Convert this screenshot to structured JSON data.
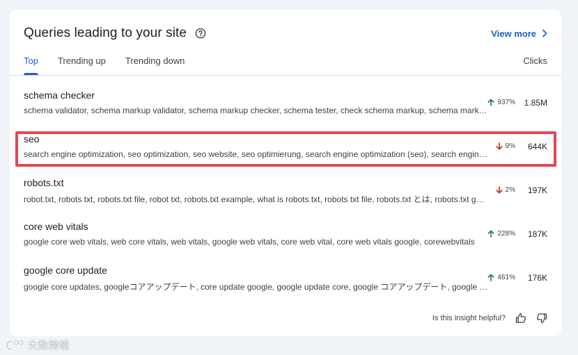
{
  "header": {
    "title": "Queries leading to your site",
    "view_more": "View more"
  },
  "tabs": [
    {
      "label": "Top",
      "active": true
    },
    {
      "label": "Trending up",
      "active": false
    },
    {
      "label": "Trending down",
      "active": false
    }
  ],
  "clicks_header": "Clicks",
  "rows": [
    {
      "query": "schema checker",
      "related": "schema validator, schema markup validator, schema markup checker, schema tester, check schema markup, schema markup tester, schema checker tool",
      "trend": "937%",
      "trend_direction": "up",
      "clicks": "1.85M"
    },
    {
      "query": "seo",
      "related": "search engine optimization, seo optimization, seo website, seo optimierung, search engine optimization (seo), search engine optimisation",
      "trend": "9%",
      "trend_direction": "down",
      "clicks": "644K"
    },
    {
      "query": "robots.txt",
      "related": "robot.txt, robots txt, robots.txt file, robot txt, robots.txt example, what is robots.txt, robots txt file, robots.txt とは, robots.txt generator",
      "trend": "2%",
      "trend_direction": "down",
      "clicks": "197K"
    },
    {
      "query": "core web vitals",
      "related": "google core web vitals, web core vitals, web vitals, google web vitals, core web vital, core web vitals google, corewebvitals",
      "trend": "228%",
      "trend_direction": "up",
      "clicks": "187K"
    },
    {
      "query": "google core update",
      "related": "google core updates, googleコアアップデート, core update google, google update core, google コアアップデート, google core algorithm update",
      "trend": "461%",
      "trend_direction": "up",
      "clicks": "176K"
    }
  ],
  "feedback": {
    "question": "Is this insight helpful?"
  },
  "watermark": {
    "text": "大数跨境"
  },
  "colors": {
    "accent": "#1a5fd0",
    "trend_up": "#188038",
    "trend_down": "#c5221f",
    "highlight_border": "#e04a55"
  },
  "icons": {
    "help": "help-circle-icon",
    "view_more": "chevron-right-icon",
    "up": "arrow-up-icon",
    "down": "arrow-down-icon",
    "thumbs_up": "thumbs-up-icon",
    "thumbs_down": "thumbs-down-icon"
  }
}
